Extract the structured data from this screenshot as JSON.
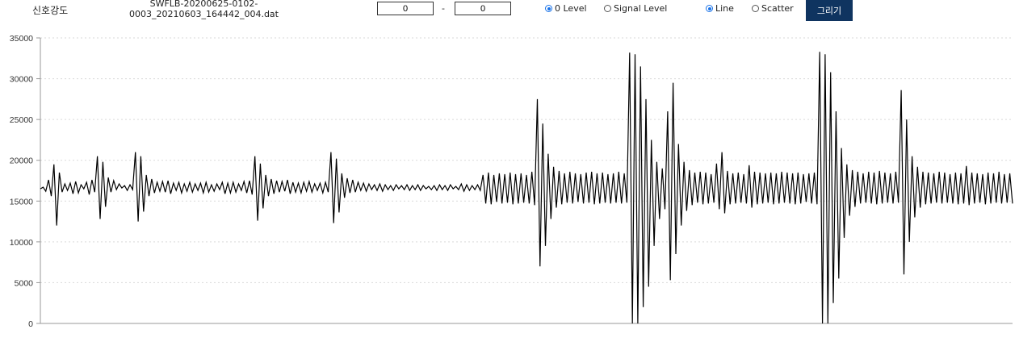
{
  "toolbar": {
    "title": "신호강도",
    "filename_line1": "SWFLB-20200625-0102-",
    "filename_line2": "0003_20210603_164442_004.dat",
    "range_from": "0",
    "range_to": "0",
    "range_separator": "-",
    "level_options": [
      {
        "label": "0 Level",
        "checked": true
      },
      {
        "label": "Signal Level",
        "checked": false
      }
    ],
    "plot_options": [
      {
        "label": "Line",
        "checked": true
      },
      {
        "label": "Scatter",
        "checked": false
      }
    ],
    "draw_button": "그리기"
  },
  "colors": {
    "accent": "#0f3460",
    "radio_selected": "#1a73e8",
    "signal": "#000000",
    "grid": "#d9d9d9"
  },
  "chart_data": {
    "type": "line",
    "y_ticks": [
      0,
      5000,
      10000,
      15000,
      20000,
      25000,
      30000,
      35000
    ],
    "ylim": [
      0,
      35000
    ],
    "grid": true,
    "series": [
      {
        "values": [
          16500,
          16700,
          16200,
          17600,
          15600,
          19500,
          12000,
          18500,
          16100,
          17100,
          16300,
          17200,
          15900,
          17400,
          16000,
          17000,
          16500,
          17300,
          15800,
          17600,
          16100,
          20500,
          12800,
          19800,
          14300,
          17900,
          16100,
          17500,
          16400,
          17100,
          16600,
          16900,
          16300,
          17000,
          16400,
          21000,
          12500,
          20500,
          13700,
          18200,
          15600,
          17700,
          16000,
          17300,
          16200,
          17400,
          16100,
          17500,
          15900,
          17200,
          16300,
          17300,
          16000,
          17100,
          16200,
          17300,
          16100,
          17100,
          16300,
          17200,
          16000,
          17300,
          16100,
          17000,
          16200,
          17100,
          16400,
          17300,
          15900,
          17200,
          16000,
          17300,
          16100,
          17100,
          16300,
          17400,
          16000,
          17500,
          15800,
          20500,
          12600,
          19600,
          14100,
          18200,
          15600,
          17700,
          15900,
          17500,
          16100,
          17400,
          16200,
          17600,
          15900,
          17300,
          16100,
          17200,
          16000,
          17300,
          16200,
          17400,
          16100,
          17100,
          16300,
          17200,
          16000,
          17300,
          16100,
          21000,
          12300,
          20200,
          13600,
          18400,
          15400,
          17800,
          16000,
          17600,
          16100,
          17300,
          16300,
          17200,
          16200,
          17100,
          16400,
          17000,
          16300,
          17100,
          16200,
          17000,
          16400,
          16900,
          16300,
          17000,
          16500,
          16900,
          16400,
          17000,
          16300,
          16900,
          16400,
          17000,
          16300,
          16900,
          16500,
          16800,
          16400,
          16900,
          16300,
          17000,
          16400,
          16900,
          16300,
          17000,
          16500,
          16800,
          16400,
          17100,
          16200,
          17000,
          16300,
          16900,
          16400,
          17000,
          16300,
          18200,
          14700,
          18500,
          14600,
          18200,
          14900,
          18400,
          14700,
          18300,
          14800,
          18500,
          14600,
          18300,
          14700,
          18400,
          14800,
          18200,
          14700,
          18600,
          14500,
          27500,
          7000,
          24500,
          9500,
          20800,
          12800,
          19200,
          14200,
          18700,
          14600,
          18400,
          14800,
          18600,
          14700,
          18400,
          14900,
          18300,
          14700,
          18500,
          14800,
          18600,
          14600,
          18400,
          14700,
          18500,
          14800,
          18300,
          14700,
          18400,
          14800,
          18600,
          14700,
          18400,
          14800,
          33200,
          0,
          33000,
          0,
          31500,
          2000,
          27500,
          4500,
          22500,
          9500,
          19800,
          12800,
          19000,
          14000,
          26000,
          5300,
          29500,
          8500,
          22000,
          12000,
          19800,
          13800,
          18800,
          14500,
          18500,
          14800,
          18600,
          14600,
          18500,
          14700,
          18300,
          14800,
          19600,
          14000,
          21000,
          13500,
          18700,
          14600,
          18400,
          14700,
          18500,
          14800,
          18300,
          14700,
          19400,
          14200,
          18600,
          14600,
          18500,
          14700,
          18400,
          14800,
          18500,
          14600,
          18400,
          14700,
          18600,
          14800,
          18500,
          14700,
          18400,
          14600,
          18500,
          14700,
          18300,
          14900,
          18400,
          14700,
          18500,
          14600,
          33300,
          0,
          33000,
          0,
          30800,
          2500,
          26000,
          5500,
          21500,
          10500,
          19500,
          13200,
          18800,
          14300,
          18600,
          14700,
          18400,
          14800,
          18600,
          14700,
          18500,
          14600,
          18700,
          14700,
          18500,
          14800,
          18400,
          14700,
          18600,
          14800,
          28600,
          6000,
          25000,
          10000,
          20500,
          13000,
          19200,
          14200,
          18600,
          14600,
          18500,
          14700,
          18400,
          14800,
          18600,
          14700,
          18500,
          14800,
          18300,
          14700,
          18500,
          14600,
          18400,
          14700,
          19300,
          14500,
          18500,
          14700,
          18400,
          14800,
          18300,
          14600,
          18500,
          14700,
          18400,
          14800,
          18600,
          14700,
          18300,
          14800,
          18400,
          14700
        ]
      }
    ]
  }
}
